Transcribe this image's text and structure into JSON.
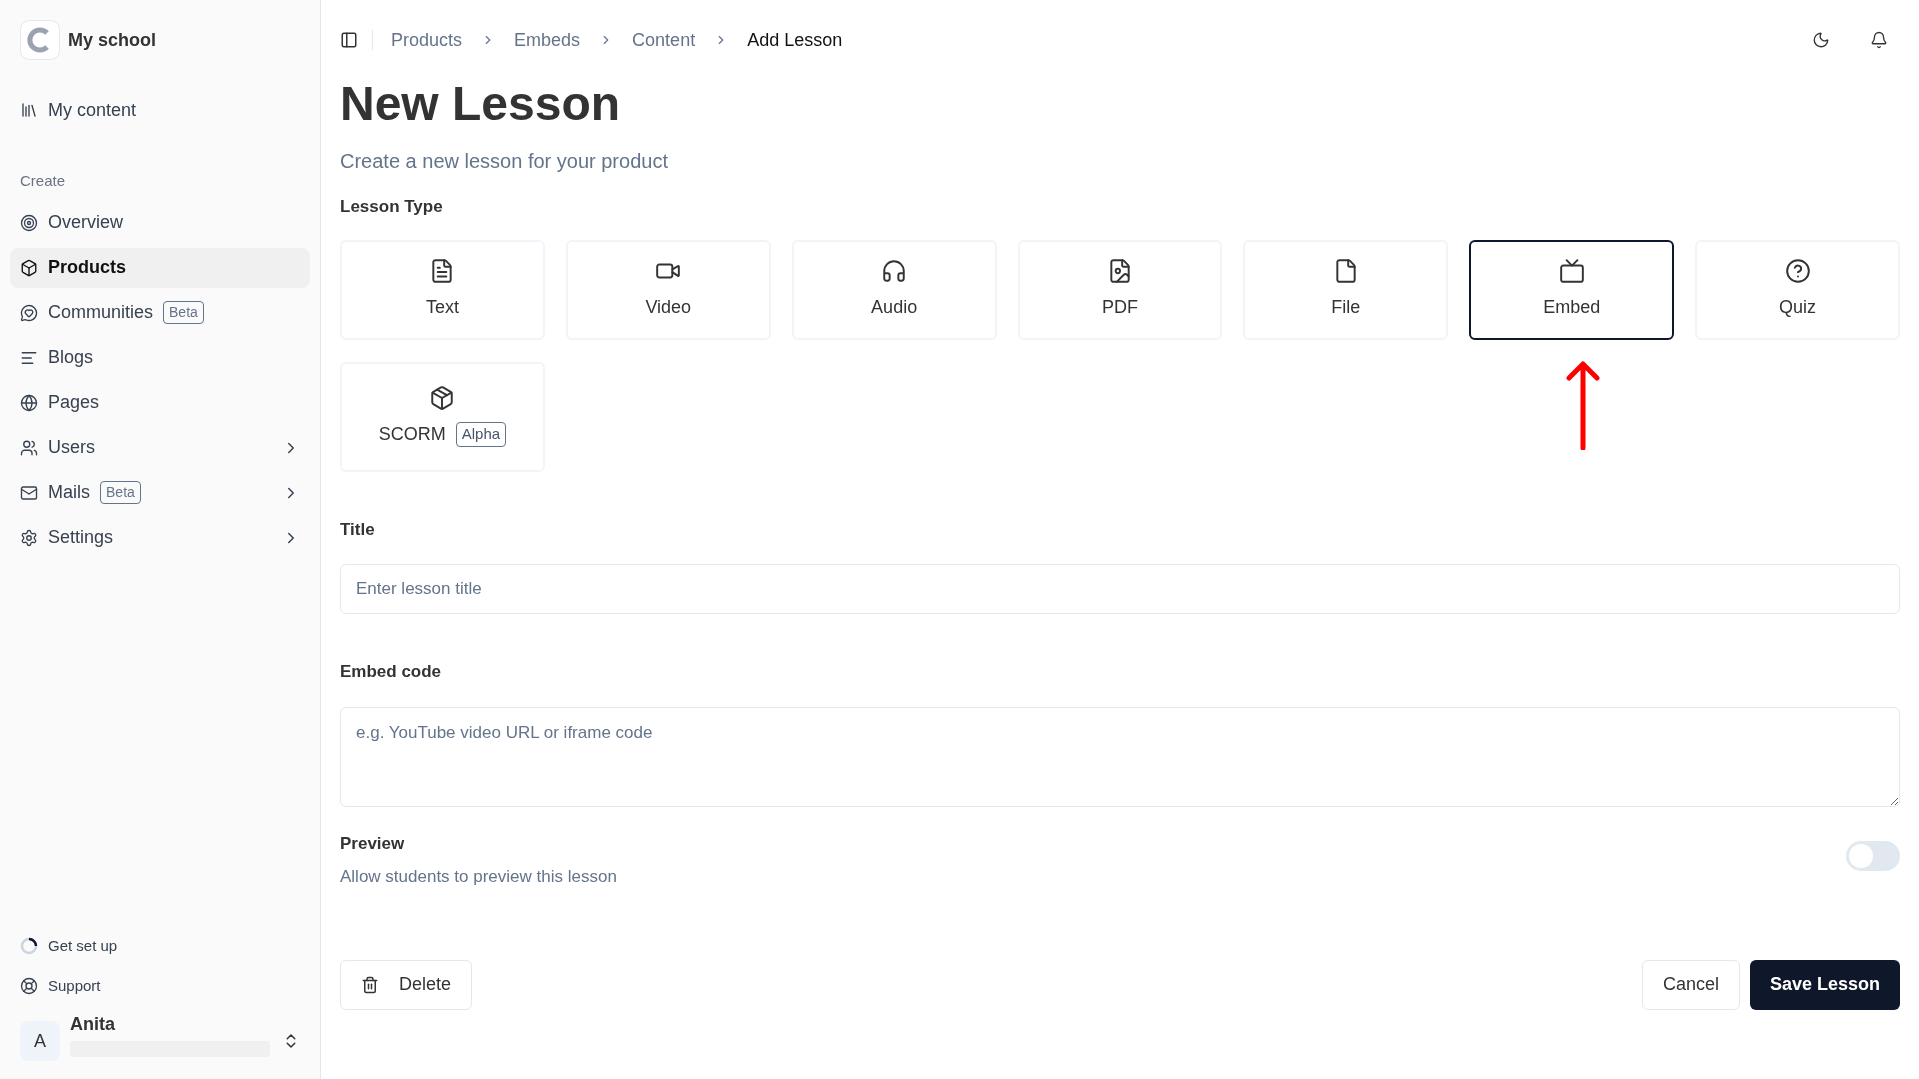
{
  "sidebar": {
    "school_name": "My school",
    "top_item": {
      "label": "My content"
    },
    "section_label": "Create",
    "items": [
      {
        "label": "Overview",
        "selected": false
      },
      {
        "label": "Products",
        "selected": true
      },
      {
        "label": "Communities",
        "selected": false,
        "badge": "Beta"
      },
      {
        "label": "Blogs",
        "selected": false
      },
      {
        "label": "Pages",
        "selected": false
      },
      {
        "label": "Users",
        "selected": false,
        "has_submenu": true
      },
      {
        "label": "Mails",
        "selected": false,
        "badge": "Beta",
        "has_submenu": true
      },
      {
        "label": "Settings",
        "selected": false,
        "has_submenu": true
      }
    ],
    "footer_items": [
      {
        "label": "Get set up"
      },
      {
        "label": "Support"
      }
    ],
    "user": {
      "initial": "A",
      "name": "Anita"
    }
  },
  "breadcrumbs": [
    {
      "label": "Products",
      "current": false
    },
    {
      "label": "Embeds",
      "current": false
    },
    {
      "label": "Content",
      "current": false
    },
    {
      "label": "Add Lesson",
      "current": true
    }
  ],
  "page": {
    "title": "New Lesson",
    "subtitle": "Create a new lesson for your product"
  },
  "lesson_type": {
    "label": "Lesson Type",
    "options": [
      {
        "label": "Text",
        "selected": false
      },
      {
        "label": "Video",
        "selected": false
      },
      {
        "label": "Audio",
        "selected": false
      },
      {
        "label": "PDF",
        "selected": false
      },
      {
        "label": "File",
        "selected": false
      },
      {
        "label": "Embed",
        "selected": true
      },
      {
        "label": "Quiz",
        "selected": false
      },
      {
        "label": "SCORM",
        "selected": false,
        "badge": "Alpha"
      }
    ],
    "annotation_arrow": true
  },
  "title_field": {
    "label": "Title",
    "placeholder": "Enter lesson title"
  },
  "embed_field": {
    "label": "Embed code",
    "placeholder": "e.g. YouTube video URL or iframe code"
  },
  "preview": {
    "label": "Preview",
    "description": "Allow students to preview this lesson",
    "on": false
  },
  "buttons": {
    "delete": "Delete",
    "cancel": "Cancel",
    "save": "Save Lesson"
  }
}
